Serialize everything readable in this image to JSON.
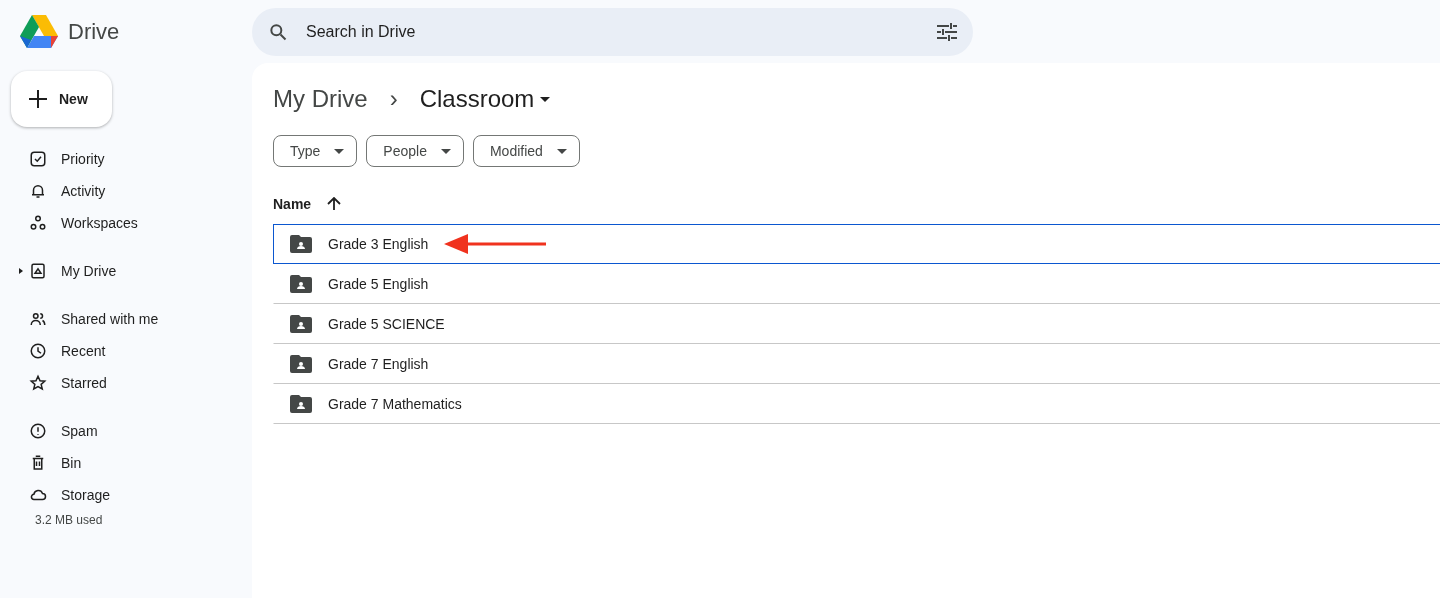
{
  "app": {
    "name": "Drive"
  },
  "search": {
    "placeholder": "Search in Drive"
  },
  "new_button": {
    "label": "New"
  },
  "sidebar": {
    "groups": [
      [
        {
          "label": "Priority"
        },
        {
          "label": "Activity"
        },
        {
          "label": "Workspaces"
        }
      ],
      [
        {
          "label": "My Drive",
          "expanded": false
        }
      ],
      [
        {
          "label": "Shared with me"
        },
        {
          "label": "Recent"
        },
        {
          "label": "Starred"
        }
      ],
      [
        {
          "label": "Spam"
        },
        {
          "label": "Bin"
        },
        {
          "label": "Storage"
        }
      ]
    ],
    "storage_used": "3.2 MB used"
  },
  "breadcrumb": {
    "parent": "My Drive",
    "separator": "›",
    "current": "Classroom"
  },
  "filters": [
    {
      "label": "Type"
    },
    {
      "label": "People"
    },
    {
      "label": "Modified"
    }
  ],
  "table": {
    "columns": [
      {
        "label": "Name",
        "sorted_ascending": true
      }
    ],
    "rows": [
      {
        "name": "Grade 3 English",
        "selected": true
      },
      {
        "name": "Grade 5 English",
        "selected": false
      },
      {
        "name": "Grade 5 SCIENCE",
        "selected": false
      },
      {
        "name": "Grade 7 English",
        "selected": false
      },
      {
        "name": "Grade 7 Mathematics",
        "selected": false
      }
    ]
  }
}
